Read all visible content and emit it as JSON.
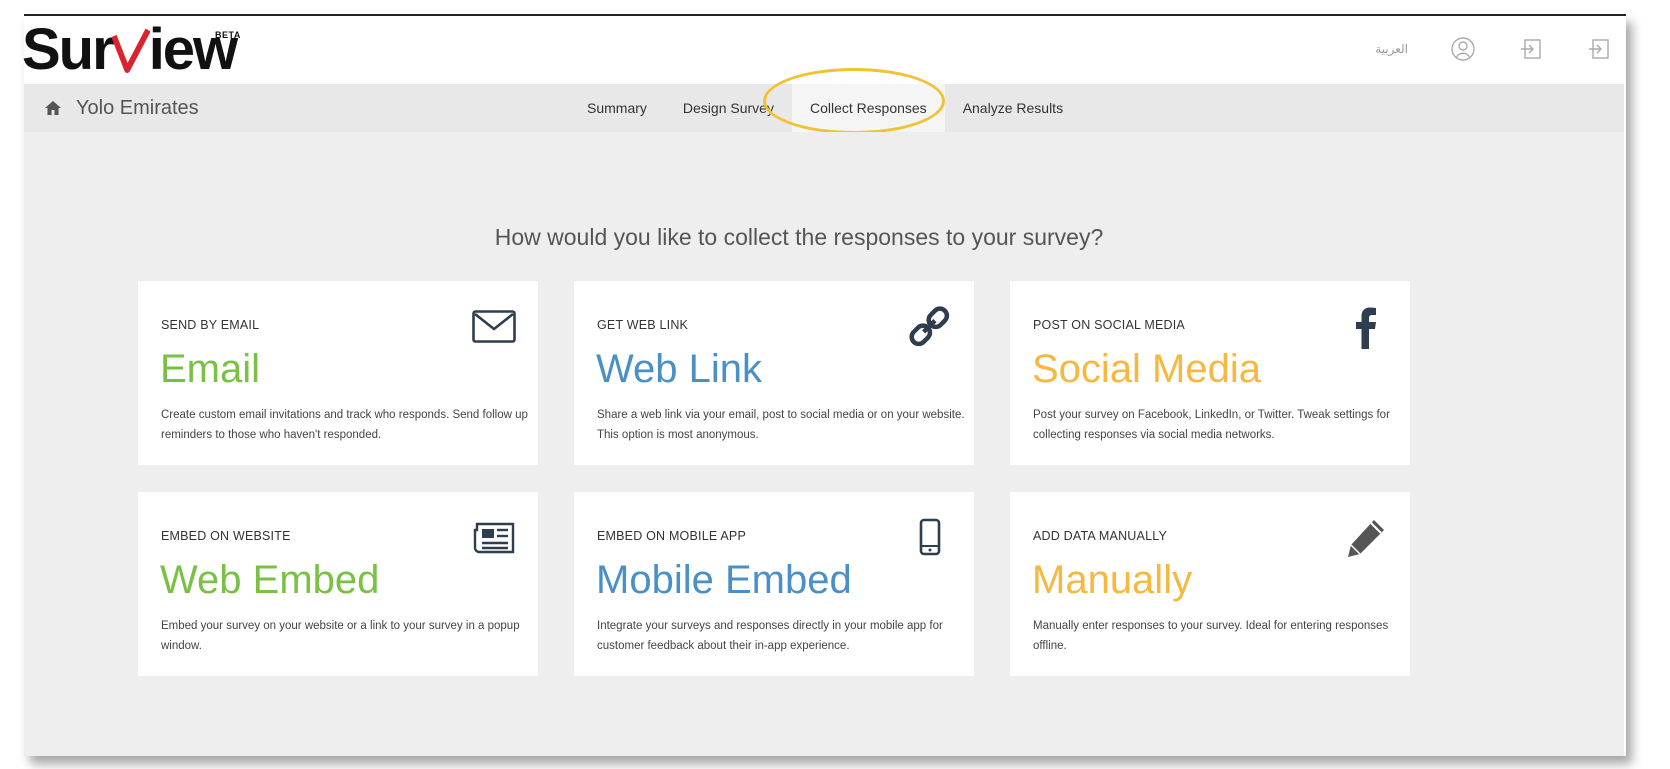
{
  "app": {
    "logo_text_before": "Sur",
    "logo_text_v": "V",
    "logo_text_after": "iew",
    "logo_badge": "BETA"
  },
  "header": {
    "language_label": "العربية",
    "icons": [
      "user-circle-icon",
      "sign-in-icon",
      "sign-out-icon"
    ]
  },
  "nav": {
    "home_icon": "home-icon",
    "brand_name": "Yolo Emirates",
    "tabs": [
      {
        "label": "Summary",
        "active": false
      },
      {
        "label": "Design Survey",
        "active": false
      },
      {
        "label": "Collect Responses",
        "active": true
      },
      {
        "label": "Analyze Results",
        "active": false
      }
    ],
    "highlight_color": "#f1c232"
  },
  "main": {
    "question": "How would you like to collect the responses to your survey?",
    "cards": [
      {
        "kicker": "SEND BY EMAIL",
        "title": "Email",
        "desc": "Create custom email invitations and track who responds. Send follow up reminders to those who haven't responded.",
        "icon": "envelope-icon",
        "color": "#7ac143"
      },
      {
        "kicker": "GET WEB LINK",
        "title": "Web Link",
        "desc": "Share a web link via your email, post to social media or on your website. This option is most anonymous.",
        "icon": "link-icon",
        "color": "#4a90c8"
      },
      {
        "kicker": "POST ON SOCIAL MEDIA",
        "title": "Social Media",
        "desc": "Post your survey on Facebook, LinkedIn, or Twitter. Tweak settings for collecting responses via social media networks.",
        "icon": "facebook-icon",
        "color": "#f6b83f"
      },
      {
        "kicker": "EMBED ON WEBSITE",
        "title": "Web Embed",
        "desc": "Embed your survey on your website or a link to your survey in a popup window.",
        "icon": "newspaper-icon",
        "color": "#7ac143"
      },
      {
        "kicker": "EMBED ON MOBILE APP",
        "title": "Mobile Embed",
        "desc": "Integrate your surveys and responses directly in your mobile app for customer feedback about their in-app experience.",
        "icon": "mobile-phone-icon",
        "color": "#4a90c8"
      },
      {
        "kicker": "ADD DATA MANUALLY",
        "title": "Manually",
        "desc": "Manually enter responses to your survey. Ideal for entering responses offline.",
        "icon": "pencil-icon",
        "color": "#f6b83f"
      }
    ]
  }
}
